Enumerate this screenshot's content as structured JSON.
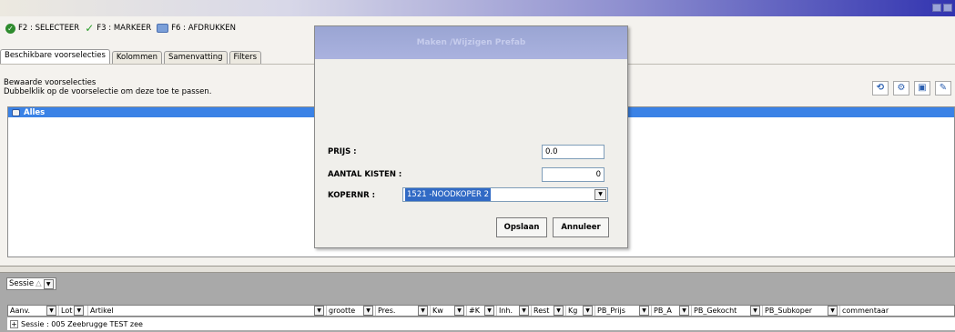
{
  "toolbar": {
    "f2": "F2 : SELECTEER",
    "f3": "F3 : MARKEER",
    "f6": "F6 : AFDRUKKEN"
  },
  "tabs": [
    "Beschikbare voorselecties",
    "Kolommen",
    "Samenvatting",
    "Filters"
  ],
  "panel": {
    "heading": "Bewaarde voorselecties",
    "subheading": "Dubbelklik op de voorselectie om deze toe te passen.",
    "selected_item": "Alles"
  },
  "modal": {
    "title": "Maken /Wijzigen Prefab",
    "prijs_label": "PRIJS :",
    "prijs_value": "0.0",
    "kisten_label": "AANTAL KISTEN :",
    "kisten_value": "0",
    "koper_label": "KOPERNR :",
    "koper_value": "1521 -NOODKOPER 2",
    "save_button": "Opslaan",
    "cancel_button": "Annuleer"
  },
  "grid": {
    "group_by": "Sessie",
    "group_row": "Sessie : 005 Zeebrugge TEST zee",
    "columns": [
      "Aanv.",
      "Lot",
      "Artikel",
      "grootte",
      "Pres.",
      "Kw",
      "#K",
      "Inh.",
      "Rest",
      "Kg",
      "PB_Prijs",
      "PB_A",
      "PB_Gekocht",
      "PB_Subkoper",
      "commentaar"
    ]
  }
}
